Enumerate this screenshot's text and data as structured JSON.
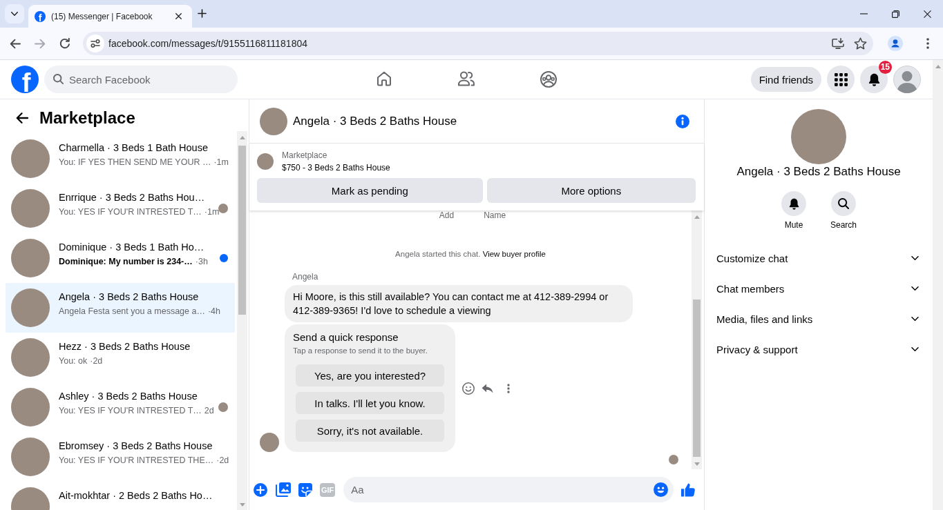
{
  "browser": {
    "tabs": [
      {
        "favicon": "f",
        "title": "(15) Messenger | Facebook",
        "selected": true
      }
    ],
    "url": "facebook.com/messages/t/9155116811181804"
  },
  "header": {
    "logo": "f",
    "search": {
      "placeholder": "Search Facebook"
    },
    "nav": [
      {
        "kind": "home",
        "selected": false
      },
      {
        "kind": "friends",
        "selected": false
      },
      {
        "kind": "groups",
        "selected": false
      }
    ],
    "find_friends": "Find friends",
    "notification_count": "15"
  },
  "sidebar": {
    "title": "Marketplace",
    "conversations": [
      {
        "title": "Charmella · 3 Beds 1 Bath House",
        "preview": "You: IF YES THEN SEND ME YOUR …",
        "time": "·1m",
        "unread": false,
        "read_receipt": false,
        "selected": false
      },
      {
        "title": "Enrrique · 3 Beds 2 Baths Hou…",
        "preview": "You: YES IF YOU'R INTRESTED T…",
        "time": "·1m",
        "unread": false,
        "read_receipt": true,
        "selected": false
      },
      {
        "title": "Dominique · 3 Beds 1 Bath Ho…",
        "preview": "Dominique: My number is 234-…",
        "time": "·3h",
        "unread": true,
        "read_receipt": false,
        "selected": false
      },
      {
        "title": "Angela · 3 Beds 2 Baths House",
        "preview": "Angela Festa sent you a message a…",
        "time": "·4h",
        "unread": false,
        "read_receipt": false,
        "selected": true
      },
      {
        "title": "Hezz · 3 Beds 2 Baths House",
        "preview": "You: ok",
        "time": "·2d",
        "unread": false,
        "read_receipt": false,
        "selected": false
      },
      {
        "title": "Ashley · 3 Beds 2 Baths House",
        "preview": "You: YES IF YOU'R INTRESTED T…",
        "time": "2d",
        "unread": false,
        "read_receipt": true,
        "selected": false
      },
      {
        "title": "Ebromsey · 3 Beds 2 Baths House",
        "preview": "You: YES IF YOU'R INTRESTED THE…",
        "time": "·2d",
        "unread": false,
        "read_receipt": false,
        "selected": false
      },
      {
        "title": "Ait-mokhtar · 2 Beds 2 Baths Ho…",
        "unread": false,
        "read_receipt": false,
        "selected": false
      }
    ]
  },
  "chat": {
    "title": "Angela · 3 Beds 2 Baths House",
    "listing": {
      "label": "Marketplace",
      "title": "$750 - 3 Beds 2 Baths House",
      "actions": [
        "Mark as pending",
        "More options"
      ]
    },
    "clipped_labels": [
      "Add",
      "Name"
    ],
    "system_note": {
      "text": "Angela started this chat.",
      "link": "View buyer profile"
    },
    "messages": [
      {
        "kind": "text",
        "sender": "Angela",
        "text": "Hi Moore, is this still available? You can contact me at 412-389-2994 or 412-389-9365! I'd love to schedule a viewing"
      },
      {
        "kind": "quick_responses",
        "title": "Send a quick response",
        "subtitle": "Tap a response to send it to the buyer.",
        "options": [
          "Yes, are you interested?",
          "In talks. I'll let you know.",
          "Sorry, it's not available."
        ]
      }
    ],
    "composer": {
      "tools": [
        {
          "kind": "plus"
        },
        {
          "kind": "image"
        },
        {
          "kind": "sticker"
        },
        {
          "kind": "gif",
          "text": "GIF"
        }
      ],
      "placeholder": "Aa"
    }
  },
  "info_panel": {
    "title": "Angela · 3 Beds 2 Baths House",
    "actions": [
      {
        "kind": "mute",
        "label": "Mute"
      },
      {
        "kind": "search",
        "label": "Search"
      }
    ],
    "sections": [
      {
        "label": "Customize chat",
        "expanded": false
      },
      {
        "label": "Chat members",
        "expanded": false
      },
      {
        "label": "Media, files and links",
        "expanded": false
      },
      {
        "label": "Privacy & support",
        "expanded": false
      }
    ]
  }
}
